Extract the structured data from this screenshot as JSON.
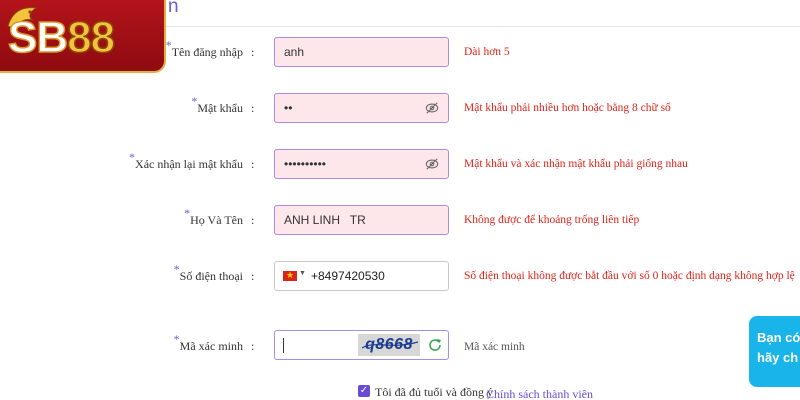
{
  "page": {
    "heading": "n"
  },
  "logo": {
    "text_sb": "SB",
    "text_88": "88"
  },
  "form": {
    "username": {
      "required_mark": "*",
      "label": "Tên đăng nhập",
      "colon": ":",
      "value": "anh",
      "error": "Dài hơn 5"
    },
    "password": {
      "required_mark": "*",
      "label": "Mật khẩu",
      "colon": ":",
      "value": "••",
      "error": "Mật khẩu phải nhiều hơn hoặc bằng 8 chữ số"
    },
    "confirm_password": {
      "required_mark": "*",
      "label": "Xác nhận lại mật khẩu",
      "colon": ":",
      "value": "••••••••••",
      "error": "Mật khẩu và xác nhận mật khẩu phải giống nhau"
    },
    "full_name": {
      "required_mark": "*",
      "label": "Họ Và Tên",
      "colon": ":",
      "value": "ANH LINH   TR",
      "error": "Không được để khoảng trống liên tiếp"
    },
    "phone": {
      "required_mark": "*",
      "label": "Số điện thoại",
      "colon": ":",
      "value": "+8497420530",
      "error": "Số điện thoại không được bắt đầu với số 0 hoặc định dạng không hợp lệ"
    },
    "captcha": {
      "required_mark": "*",
      "label": "Mã xác minh",
      "colon": ":",
      "value": "",
      "image_code": "q8668",
      "hint": "Mã xác minh"
    }
  },
  "agree": {
    "checked": true,
    "text": "Tôi đã đủ tuổi và đồng ý",
    "link": "Chính sách thành viên"
  },
  "chat": {
    "line1": "Bạn có",
    "line2": "hãy ch"
  },
  "colors": {
    "accent": "#6c5bd4",
    "error": "#e2231a",
    "field_bg": "#fde7ea",
    "chat": "#19b5ea",
    "logo_red": "#b3141a"
  },
  "icons": {
    "eye": "eye-off-icon",
    "refresh": "refresh-icon",
    "flag": "vietnam-flag-icon"
  }
}
